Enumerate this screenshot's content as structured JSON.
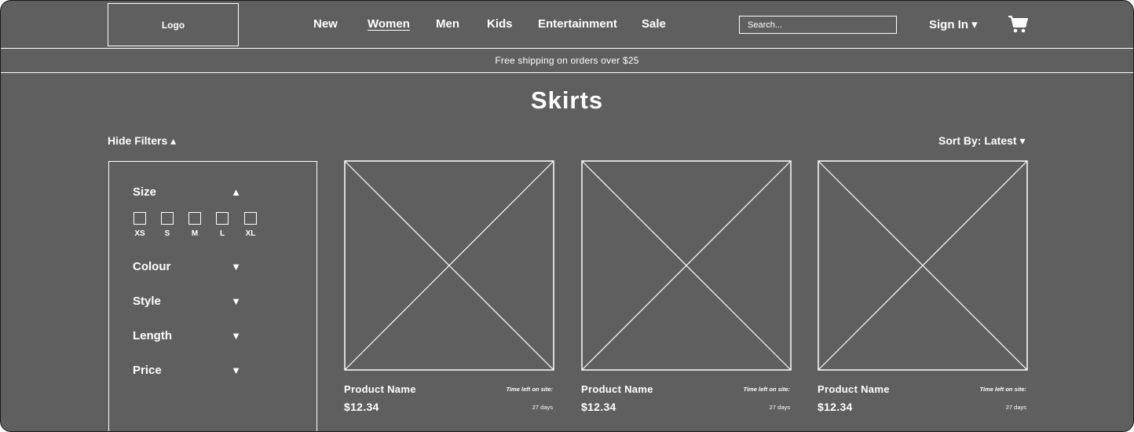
{
  "header": {
    "logo_text": "Logo",
    "nav": [
      {
        "label": "New",
        "active": false
      },
      {
        "label": "Women",
        "active": true
      },
      {
        "label": "Men",
        "active": false
      },
      {
        "label": "Kids",
        "active": false
      },
      {
        "label": "Entertainment",
        "active": false
      },
      {
        "label": "Sale",
        "active": false
      }
    ],
    "search_placeholder": "Search...",
    "signin_label": "Sign In ▾",
    "cart_icon": "cart-icon"
  },
  "banner": {
    "shipping_text": "Free shipping on orders over $25"
  },
  "page": {
    "title": "Skirts",
    "hide_filters_label": "Hide Filters ▴",
    "sort_by_label": "Sort By: Latest ▾"
  },
  "filters": {
    "size": {
      "label": "Size",
      "arrow": "▲",
      "options": [
        "XS",
        "S",
        "M",
        "L",
        "XL"
      ]
    },
    "colour": {
      "label": "Colour",
      "arrow": "▼"
    },
    "style": {
      "label": "Style",
      "arrow": "▼"
    },
    "length": {
      "label": "Length",
      "arrow": "▼"
    },
    "price": {
      "label": "Price",
      "arrow": "▼"
    }
  },
  "products": [
    {
      "name": "Product Name",
      "price": "$12.34",
      "time_label": "Time left on site:",
      "time_value": "27 days"
    },
    {
      "name": "Product Name",
      "price": "$12.34",
      "time_label": "Time left on site:",
      "time_value": "27 days"
    },
    {
      "name": "Product Name",
      "price": "$12.34",
      "time_label": "Time left on site:",
      "time_value": "27 days"
    }
  ],
  "colors": {
    "background": "#5f5f5f",
    "foreground": "#ffffff"
  }
}
